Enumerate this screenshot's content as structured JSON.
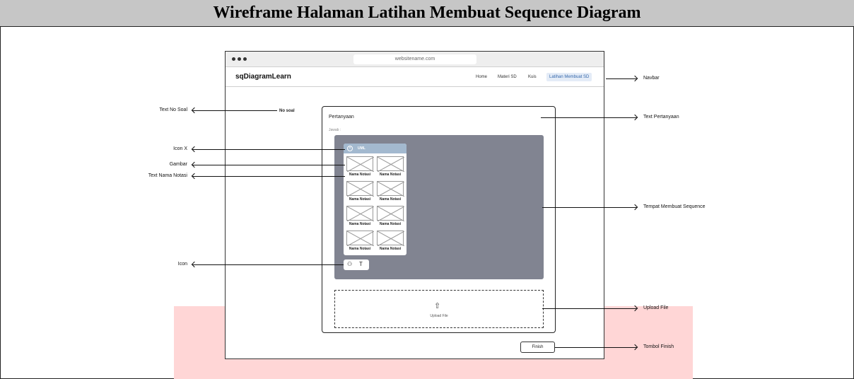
{
  "title": "Wireframe Halaman Latihan Membuat Sequence Diagram",
  "browser": {
    "url": "websitename.com",
    "brand": "sqDiagramLearn",
    "nav": [
      "Home",
      "Materi SD",
      "Kuis",
      "Latihan Membuat SD"
    ]
  },
  "page": {
    "no_soal": "No soal",
    "question": "Pertanyaan",
    "answer_label": "Jawab :",
    "palette_title": "UML",
    "notation_label": "Nama Notasi",
    "upload_label": "Upload File",
    "finish_button": "Finish"
  },
  "annotations": {
    "left": [
      "Text No Soal",
      "Icon X",
      "Gambar",
      "Text Nama Notasi",
      "Icon"
    ],
    "right": [
      "Navbar",
      "Text Pertanyaan",
      "Tempat Membuat Sequence",
      "Upload File",
      "Tombol Finish"
    ]
  },
  "colors": {
    "title_bar": "#c6c6c6",
    "canvas": "#818491",
    "palette_header": "#a3b9cf",
    "highlight": "#ffd6d6"
  }
}
